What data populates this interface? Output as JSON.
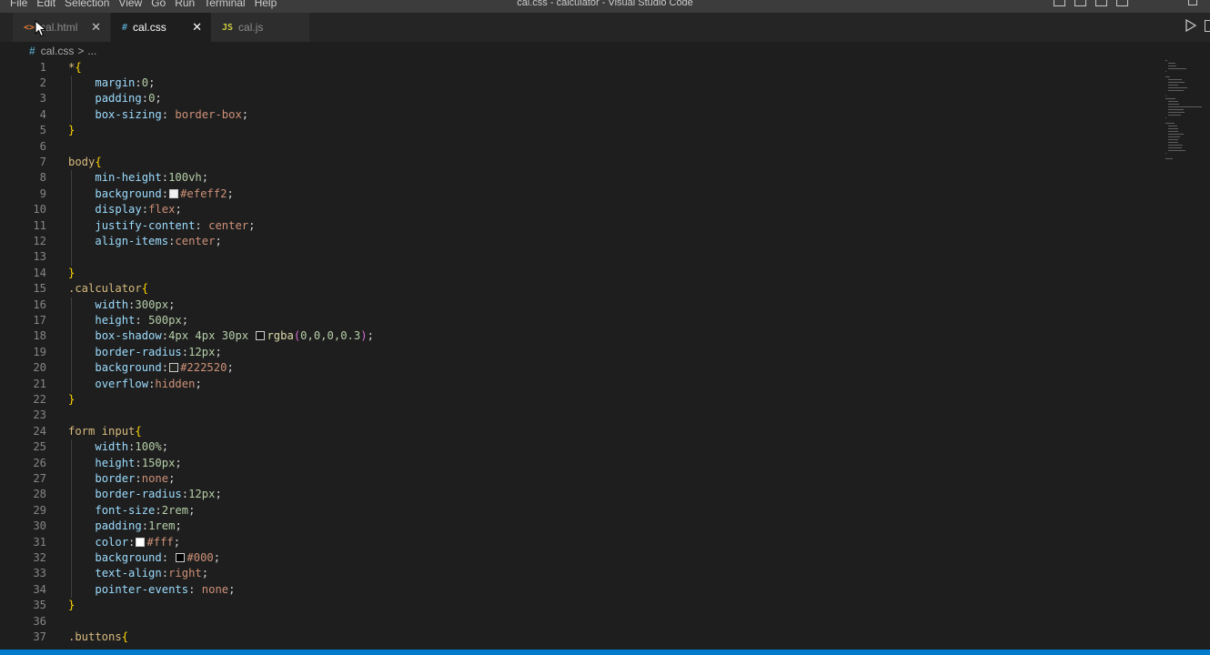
{
  "menu": {
    "items": [
      "File",
      "Edit",
      "Selection",
      "View",
      "Go",
      "Run",
      "Terminal",
      "Help"
    ],
    "window_title": "cal.css - calculator - Visual Studio Code"
  },
  "tabs": [
    {
      "label": "cal.html",
      "icon": "<>",
      "active": false
    },
    {
      "label": "cal.css",
      "icon": "#",
      "active": true
    },
    {
      "label": "cal.js",
      "icon": "JS",
      "active": false
    }
  ],
  "breadcrumb": {
    "hash": "#",
    "file": "cal.css",
    "sep": ">",
    "more": "..."
  },
  "colors": {
    "accent": "#007acc",
    "editor_bg": "#1e1e1e",
    "html_icon": "#e37933",
    "css_icon": "#519aba",
    "js_icon": "#cbcb41"
  },
  "editor": {
    "lines": [
      {
        "n": "1",
        "tokens": [
          {
            "t": "*",
            "c": "t-sel"
          },
          {
            "t": "{",
            "c": "t-brace"
          }
        ]
      },
      {
        "n": "2",
        "tokens": [
          {
            "t": "    "
          },
          {
            "t": "margin",
            "c": "t-prop"
          },
          {
            "t": ":"
          },
          {
            "t": "0",
            "c": "t-num"
          },
          {
            "t": ";"
          }
        ]
      },
      {
        "n": "3",
        "tokens": [
          {
            "t": "    "
          },
          {
            "t": "padding",
            "c": "t-prop"
          },
          {
            "t": ":"
          },
          {
            "t": "0",
            "c": "t-num"
          },
          {
            "t": ";"
          }
        ]
      },
      {
        "n": "4",
        "tokens": [
          {
            "t": "    "
          },
          {
            "t": "box-sizing",
            "c": "t-prop"
          },
          {
            "t": ": "
          },
          {
            "t": "border-box",
            "c": "t-val"
          },
          {
            "t": ";"
          }
        ]
      },
      {
        "n": "5",
        "tokens": [
          {
            "t": "}",
            "c": "t-brace"
          }
        ]
      },
      {
        "n": "6",
        "tokens": []
      },
      {
        "n": "7",
        "tokens": [
          {
            "t": "body",
            "c": "t-sel"
          },
          {
            "t": "{",
            "c": "t-brace"
          }
        ]
      },
      {
        "n": "8",
        "tokens": [
          {
            "t": "    "
          },
          {
            "t": "min-height",
            "c": "t-prop"
          },
          {
            "t": ":"
          },
          {
            "t": "100vh",
            "c": "t-num"
          },
          {
            "t": ";"
          }
        ]
      },
      {
        "n": "9",
        "tokens": [
          {
            "t": "    "
          },
          {
            "t": "background",
            "c": "t-prop"
          },
          {
            "t": ":"
          },
          {
            "swatch": "#efeff2"
          },
          {
            "t": "#efeff2",
            "c": "t-val"
          },
          {
            "t": ";"
          }
        ]
      },
      {
        "n": "10",
        "tokens": [
          {
            "t": "    "
          },
          {
            "t": "display",
            "c": "t-prop"
          },
          {
            "t": ":"
          },
          {
            "t": "flex",
            "c": "t-val"
          },
          {
            "t": ";"
          }
        ]
      },
      {
        "n": "11",
        "tokens": [
          {
            "t": "    "
          },
          {
            "t": "justify-content",
            "c": "t-prop"
          },
          {
            "t": ": "
          },
          {
            "t": "center",
            "c": "t-val"
          },
          {
            "t": ";"
          }
        ]
      },
      {
        "n": "12",
        "tokens": [
          {
            "t": "    "
          },
          {
            "t": "align-items",
            "c": "t-prop"
          },
          {
            "t": ":"
          },
          {
            "t": "center",
            "c": "t-val"
          },
          {
            "t": ";"
          }
        ]
      },
      {
        "n": "13",
        "tokens": []
      },
      {
        "n": "14",
        "tokens": [
          {
            "t": "}",
            "c": "t-brace"
          }
        ]
      },
      {
        "n": "15",
        "tokens": [
          {
            "t": ".calculator",
            "c": "t-sel"
          },
          {
            "t": "{",
            "c": "t-brace"
          }
        ]
      },
      {
        "n": "16",
        "tokens": [
          {
            "t": "    "
          },
          {
            "t": "width",
            "c": "t-prop"
          },
          {
            "t": ":"
          },
          {
            "t": "300px",
            "c": "t-num"
          },
          {
            "t": ";"
          }
        ]
      },
      {
        "n": "17",
        "tokens": [
          {
            "t": "    "
          },
          {
            "t": "height",
            "c": "t-prop"
          },
          {
            "t": ": "
          },
          {
            "t": "500px",
            "c": "t-num"
          },
          {
            "t": ";"
          }
        ]
      },
      {
        "n": "18",
        "tokens": [
          {
            "t": "    "
          },
          {
            "t": "box-shadow",
            "c": "t-prop"
          },
          {
            "t": ":"
          },
          {
            "t": "4px 4px 30px ",
            "c": "t-num"
          },
          {
            "swatch": "rgba(0,0,0,0.3)"
          },
          {
            "t": "rgba",
            "c": "t-fn"
          },
          {
            "t": "(",
            "c": "t-paren"
          },
          {
            "t": "0,0,0,0.3",
            "c": "t-num"
          },
          {
            "t": ")",
            "c": "t-paren"
          },
          {
            "t": ";"
          }
        ]
      },
      {
        "n": "19",
        "tokens": [
          {
            "t": "    "
          },
          {
            "t": "border-radius",
            "c": "t-prop"
          },
          {
            "t": ":"
          },
          {
            "t": "12px",
            "c": "t-num"
          },
          {
            "t": ";"
          }
        ]
      },
      {
        "n": "20",
        "tokens": [
          {
            "t": "    "
          },
          {
            "t": "background",
            "c": "t-prop"
          },
          {
            "t": ":"
          },
          {
            "swatch": "#222520"
          },
          {
            "t": "#222520",
            "c": "t-val"
          },
          {
            "t": ";"
          }
        ]
      },
      {
        "n": "21",
        "tokens": [
          {
            "t": "    "
          },
          {
            "t": "overflow",
            "c": "t-prop"
          },
          {
            "t": ":"
          },
          {
            "t": "hidden",
            "c": "t-val"
          },
          {
            "t": ";"
          }
        ]
      },
      {
        "n": "22",
        "tokens": [
          {
            "t": "}",
            "c": "t-brace"
          }
        ]
      },
      {
        "n": "23",
        "tokens": []
      },
      {
        "n": "24",
        "tokens": [
          {
            "t": "form input",
            "c": "t-sel"
          },
          {
            "t": "{",
            "c": "t-brace"
          }
        ]
      },
      {
        "n": "25",
        "tokens": [
          {
            "t": "    "
          },
          {
            "t": "width",
            "c": "t-prop"
          },
          {
            "t": ":"
          },
          {
            "t": "100%",
            "c": "t-num"
          },
          {
            "t": ";"
          }
        ]
      },
      {
        "n": "26",
        "tokens": [
          {
            "t": "    "
          },
          {
            "t": "height",
            "c": "t-prop"
          },
          {
            "t": ":"
          },
          {
            "t": "150px",
            "c": "t-num"
          },
          {
            "t": ";"
          }
        ]
      },
      {
        "n": "27",
        "tokens": [
          {
            "t": "    "
          },
          {
            "t": "border",
            "c": "t-prop"
          },
          {
            "t": ":"
          },
          {
            "t": "none",
            "c": "t-val"
          },
          {
            "t": ";"
          }
        ]
      },
      {
        "n": "28",
        "tokens": [
          {
            "t": "    "
          },
          {
            "t": "border-radius",
            "c": "t-prop"
          },
          {
            "t": ":"
          },
          {
            "t": "12px",
            "c": "t-num"
          },
          {
            "t": ";"
          }
        ]
      },
      {
        "n": "29",
        "tokens": [
          {
            "t": "    "
          },
          {
            "t": "font-size",
            "c": "t-prop"
          },
          {
            "t": ":"
          },
          {
            "t": "2rem",
            "c": "t-num"
          },
          {
            "t": ";"
          }
        ]
      },
      {
        "n": "30",
        "tokens": [
          {
            "t": "    "
          },
          {
            "t": "padding",
            "c": "t-prop"
          },
          {
            "t": ":"
          },
          {
            "t": "1rem",
            "c": "t-num"
          },
          {
            "t": ";"
          }
        ]
      },
      {
        "n": "31",
        "tokens": [
          {
            "t": "    "
          },
          {
            "t": "color",
            "c": "t-prop"
          },
          {
            "t": ":"
          },
          {
            "swatch": "#fff"
          },
          {
            "t": "#fff",
            "c": "t-val"
          },
          {
            "t": ";"
          }
        ]
      },
      {
        "n": "32",
        "tokens": [
          {
            "t": "    "
          },
          {
            "t": "background",
            "c": "t-prop"
          },
          {
            "t": ": "
          },
          {
            "swatch": "#000"
          },
          {
            "t": "#000",
            "c": "t-val"
          },
          {
            "t": ";"
          }
        ]
      },
      {
        "n": "33",
        "tokens": [
          {
            "t": "    "
          },
          {
            "t": "text-align",
            "c": "t-prop"
          },
          {
            "t": ":"
          },
          {
            "t": "right",
            "c": "t-val"
          },
          {
            "t": ";"
          }
        ]
      },
      {
        "n": "34",
        "tokens": [
          {
            "t": "    "
          },
          {
            "t": "pointer-events",
            "c": "t-prop"
          },
          {
            "t": ": "
          },
          {
            "t": "none",
            "c": "t-val"
          },
          {
            "t": ";"
          }
        ]
      },
      {
        "n": "35",
        "tokens": [
          {
            "t": "}",
            "c": "t-brace"
          }
        ]
      },
      {
        "n": "36",
        "tokens": []
      },
      {
        "n": "37",
        "tokens": [
          {
            "t": ".buttons",
            "c": "t-sel"
          },
          {
            "t": "{",
            "c": "t-brace"
          }
        ]
      }
    ]
  }
}
